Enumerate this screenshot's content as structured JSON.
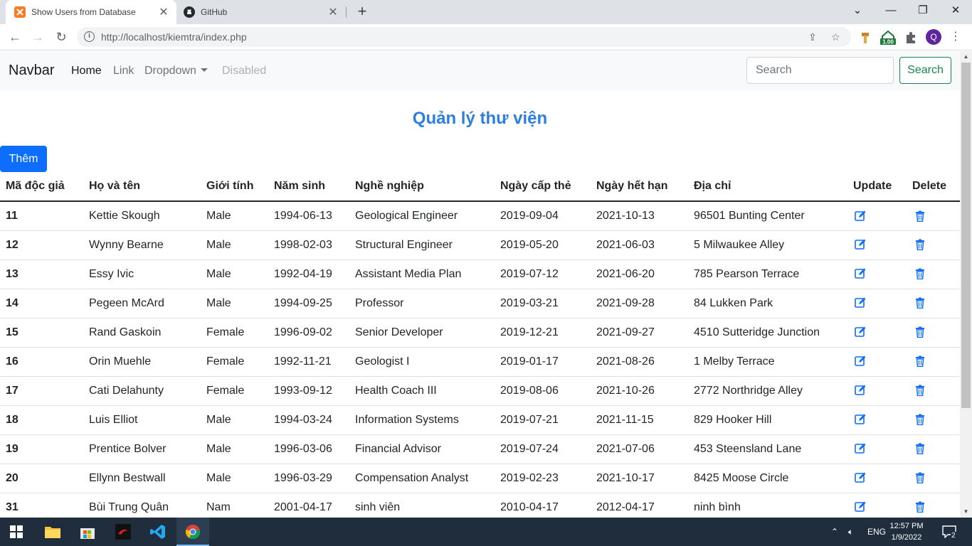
{
  "browser": {
    "tabs": [
      {
        "title": "Show Users from Database",
        "active": true
      },
      {
        "title": "GitHub",
        "active": false
      }
    ],
    "url": "http://localhost/kiemtra/index.php",
    "extension_badge": "1.00",
    "profile_initial": "Q"
  },
  "navbar": {
    "brand": "Navbar",
    "links": [
      {
        "label": "Home",
        "state": "active"
      },
      {
        "label": "Link",
        "state": "normal"
      },
      {
        "label": "Dropdown",
        "state": "dropdown"
      },
      {
        "label": "Disabled",
        "state": "disabled"
      }
    ],
    "search_placeholder": "Search",
    "search_button": "Search"
  },
  "page": {
    "title": "Quản lý thư viện",
    "add_button": "Thêm"
  },
  "table": {
    "headers": [
      "Mã độc giả",
      "Họ và tên",
      "Giới tính",
      "Năm sinh",
      "Nghề nghiệp",
      "Ngày cấp thẻ",
      "Ngày hết hạn",
      "Địa chỉ",
      "Update",
      "Delete"
    ],
    "rows": [
      [
        "11",
        "Kettie Skough",
        "Male",
        "1994-06-13",
        "Geological Engineer",
        "2019-09-04",
        "2021-10-13",
        "96501 Bunting Center"
      ],
      [
        "12",
        "Wynny Bearne",
        "Male",
        "1998-02-03",
        "Structural Engineer",
        "2019-05-20",
        "2021-06-03",
        "5 Milwaukee Alley"
      ],
      [
        "13",
        "Essy Ivic",
        "Male",
        "1992-04-19",
        "Assistant Media Plan",
        "2019-07-12",
        "2021-06-20",
        "785 Pearson Terrace"
      ],
      [
        "14",
        "Pegeen McArd",
        "Male",
        "1994-09-25",
        "Professor",
        "2019-03-21",
        "2021-09-28",
        "84 Lukken Park"
      ],
      [
        "15",
        "Rand Gaskoin",
        "Female",
        "1996-09-02",
        "Senior Developer",
        "2019-12-21",
        "2021-09-27",
        "4510 Sutteridge Junction"
      ],
      [
        "16",
        "Orin Muehle",
        "Female",
        "1992-11-21",
        "Geologist I",
        "2019-01-17",
        "2021-08-26",
        "1 Melby Terrace"
      ],
      [
        "17",
        "Cati Delahunty",
        "Female",
        "1993-09-12",
        "Health Coach III",
        "2019-08-06",
        "2021-10-26",
        "2772 Northridge Alley"
      ],
      [
        "18",
        "Luis Elliot",
        "Male",
        "1994-03-24",
        "Information Systems",
        "2019-07-21",
        "2021-11-15",
        "829 Hooker Hill"
      ],
      [
        "19",
        "Prentice Bolver",
        "Male",
        "1996-03-06",
        "Financial Advisor",
        "2019-07-24",
        "2021-07-06",
        "453 Steensland Lane"
      ],
      [
        "20",
        "Ellynn Bestwall",
        "Male",
        "1996-03-29",
        "Compensation Analyst",
        "2019-02-23",
        "2021-10-17",
        "8425 Moose Circle"
      ],
      [
        "31",
        "Bùi Trung Quân",
        "Nam",
        "2001-04-17",
        "sinh viên",
        "2010-04-17",
        "2012-04-17",
        "ninh bình"
      ]
    ]
  },
  "taskbar": {
    "language": "ENG",
    "time": "12:57 PM",
    "date": "1/9/2022",
    "notification_count": "2"
  },
  "colors": {
    "primary": "#0d6efd",
    "title": "#2e7ee0",
    "success": "#198754",
    "taskbar": "#1f2d3d"
  }
}
